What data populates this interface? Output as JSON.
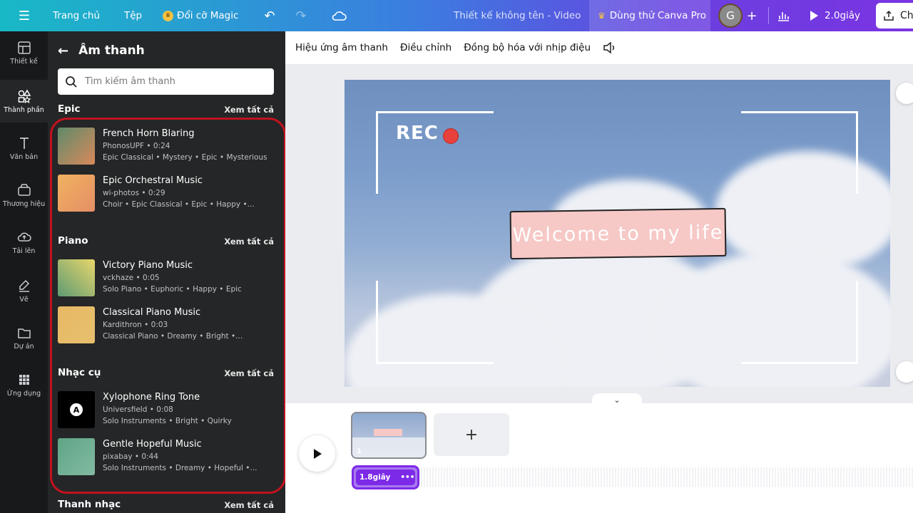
{
  "topbar": {
    "home": "Trang chủ",
    "file": "Tệp",
    "magic": "Đổi cỡ Magic",
    "title": "Thiết kế không tên - Video",
    "pro": "Dùng thử Canva Pro",
    "avatar": "G",
    "play_time": "2.0giây",
    "share": "Ch"
  },
  "rail": [
    {
      "label": "Thiết kế",
      "icon": "layout-icon"
    },
    {
      "label": "Thành phần",
      "icon": "elements-icon"
    },
    {
      "label": "Văn bản",
      "icon": "text-icon"
    },
    {
      "label": "Thương hiệu",
      "icon": "brand-icon"
    },
    {
      "label": "Tải lên",
      "icon": "upload-icon"
    },
    {
      "label": "Vẽ",
      "icon": "draw-icon"
    },
    {
      "label": "Dự án",
      "icon": "folder-icon"
    },
    {
      "label": "Ứng dụng",
      "icon": "apps-icon"
    }
  ],
  "panel": {
    "title": "Âm thanh",
    "search_placeholder": "Tìm kiếm âm thanh",
    "see_all": "Xem tất cả",
    "sections": [
      {
        "title": "Epic",
        "tracks": [
          {
            "name": "French Horn Blaring",
            "meta": "PhonosUPF • 0:24",
            "tags": "Epic Classical • Mystery • Epic • Mysterious",
            "color1": "#5f8a6a",
            "color2": "#d9895b"
          },
          {
            "name": "Epic Orchestral Music",
            "meta": "wi-photos • 0:29",
            "tags": "Choir • Epic Classical • Epic • Happy •...",
            "color1": "#f0b25f",
            "color2": "#e58f66"
          }
        ]
      },
      {
        "title": "Piano",
        "tracks": [
          {
            "name": "Victory Piano Music",
            "meta": "vckhaze • 0:05",
            "tags": "Solo Piano • Euphoric • Happy • Epic",
            "color1": "#e8d66a",
            "color2": "#5e9b74"
          },
          {
            "name": "Classical Piano Music",
            "meta": "Kardithron • 0:03",
            "tags": "Classical Piano • Dreamy • Bright •...",
            "color1": "#e7b865",
            "color2": "#e7c06d"
          }
        ]
      },
      {
        "title": "Nhạc cụ",
        "tracks": [
          {
            "name": "Xylophone Ring Tone",
            "meta": "Universfield • 0:08",
            "tags": "Solo Instruments • Bright • Quirky",
            "color1": "#000000",
            "color2": "#000000"
          },
          {
            "name": "Gentle Hopeful Music",
            "meta": "pixabay • 0:44",
            "tags": "Solo Instruments • Dreamy • Hopeful •...",
            "color1": "#5fa485",
            "color2": "#82bba2"
          }
        ]
      },
      {
        "title": "Thanh nhạc",
        "tracks": []
      }
    ]
  },
  "context_bar": [
    "Hiệu ứng âm thanh",
    "Điều chỉnh",
    "Đồng bộ hóa với nhịp điệu"
  ],
  "slide": {
    "rec": "REC",
    "welcome": "Welcome to my life"
  },
  "timeline": {
    "clip_number": "1",
    "audio_duration": "1.8giây",
    "audio_more": "•••",
    "add": "+"
  },
  "colors": {
    "accent": "#7d2ae8",
    "highlight": "#c1121f",
    "panel_bg": "#252627",
    "rail_bg": "#18191b"
  }
}
